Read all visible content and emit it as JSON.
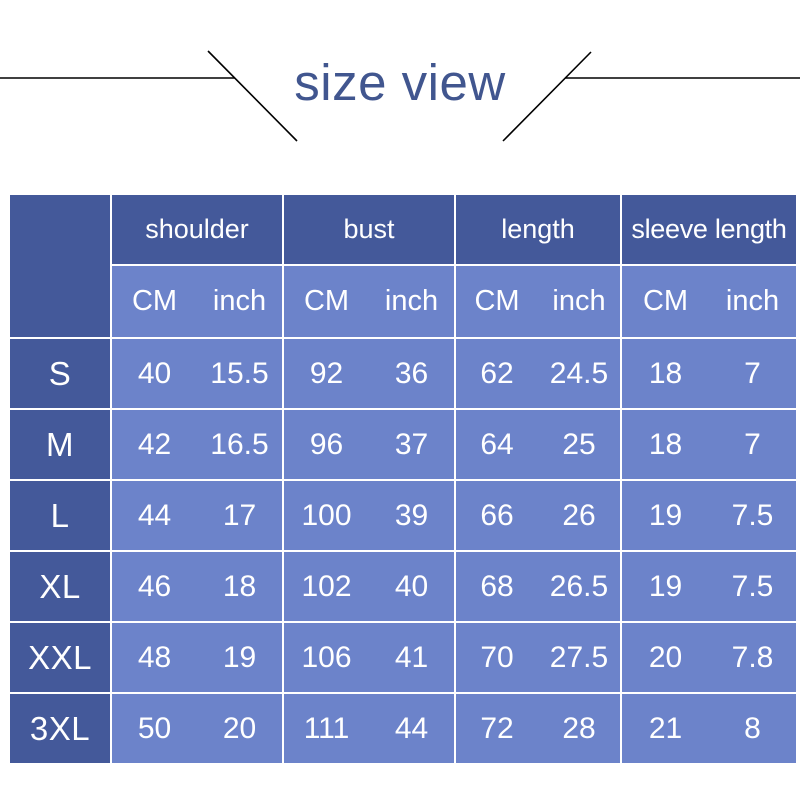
{
  "title": {
    "text": "size view",
    "color": "#41568f"
  },
  "decoration": {
    "line_color": "#000000",
    "left_rule_name": "left-horizontal-rule",
    "right_rule_name": "right-horizontal-rule"
  },
  "table": {
    "colors": {
      "header_dark": "#44599a",
      "cell_light": "#6c83ca",
      "text": "#ffffff",
      "gap": "#ffffff"
    },
    "corner_label": "",
    "measurements": [
      {
        "name": "shoulder",
        "units": [
          "CM",
          "inch"
        ]
      },
      {
        "name": "bust",
        "units": [
          "CM",
          "inch"
        ]
      },
      {
        "name": "length",
        "units": [
          "CM",
          "inch"
        ]
      },
      {
        "name": "sleeve length",
        "units": [
          "CM",
          "inch"
        ]
      }
    ],
    "rows": [
      {
        "size": "S",
        "shoulder_cm": "40",
        "shoulder_inch": "15.5",
        "bust_cm": "92",
        "bust_inch": "36",
        "length_cm": "62",
        "length_inch": "24.5",
        "sleeve_cm": "18",
        "sleeve_inch": "7"
      },
      {
        "size": "M",
        "shoulder_cm": "42",
        "shoulder_inch": "16.5",
        "bust_cm": "96",
        "bust_inch": "37",
        "length_cm": "64",
        "length_inch": "25",
        "sleeve_cm": "18",
        "sleeve_inch": "7"
      },
      {
        "size": "L",
        "shoulder_cm": "44",
        "shoulder_inch": "17",
        "bust_cm": "100",
        "bust_inch": "39",
        "length_cm": "66",
        "length_inch": "26",
        "sleeve_cm": "19",
        "sleeve_inch": "7.5"
      },
      {
        "size": "XL",
        "shoulder_cm": "46",
        "shoulder_inch": "18",
        "bust_cm": "102",
        "bust_inch": "40",
        "length_cm": "68",
        "length_inch": "26.5",
        "sleeve_cm": "19",
        "sleeve_inch": "7.5"
      },
      {
        "size": "XXL",
        "shoulder_cm": "48",
        "shoulder_inch": "19",
        "bust_cm": "106",
        "bust_inch": "41",
        "length_cm": "70",
        "length_inch": "27.5",
        "sleeve_cm": "20",
        "sleeve_inch": "7.8"
      },
      {
        "size": "3XL",
        "shoulder_cm": "50",
        "shoulder_inch": "20",
        "bust_cm": "111",
        "bust_inch": "44",
        "length_cm": "72",
        "length_inch": "28",
        "sleeve_cm": "21",
        "sleeve_inch": "8"
      }
    ]
  }
}
